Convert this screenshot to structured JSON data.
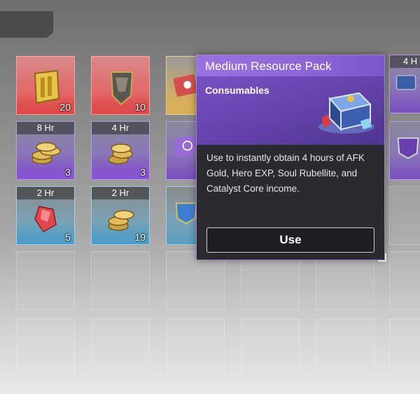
{
  "popup": {
    "title": "Medium Resource Pack",
    "category": "Consumables",
    "description": "Use to instantly obtain 4 hours of AFK Gold, Hero EXP, Soul Rubellite, and Catalyst Core income.",
    "use_label": "Use"
  },
  "grid": {
    "row1": [
      {
        "count": "20",
        "rarity": "red",
        "icon": "gold-scroll-icon"
      },
      {
        "count": "10",
        "rarity": "red",
        "icon": "dark-scroll-icon"
      }
    ],
    "row2": [
      {
        "timer": "8 Hr",
        "count": "3",
        "rarity": "purple",
        "icon": "gold-coins-icon"
      },
      {
        "timer": "4 Hr",
        "count": "3",
        "rarity": "purple",
        "icon": "gold-coins-icon"
      }
    ],
    "row3": [
      {
        "timer": "2 Hr",
        "count": "5",
        "rarity": "blue",
        "icon": "red-crystal-icon"
      },
      {
        "timer": "2 Hr",
        "count": "19",
        "rarity": "blue",
        "icon": "gold-coins-icon"
      }
    ],
    "right_partial_timer": "4 H"
  },
  "colors": {
    "popup_header": "#7b57c8",
    "popup_body": "#2b2a30",
    "rarity_red": "#e04848",
    "rarity_purple": "#8b55d6",
    "rarity_blue": "#4c9dc6"
  }
}
